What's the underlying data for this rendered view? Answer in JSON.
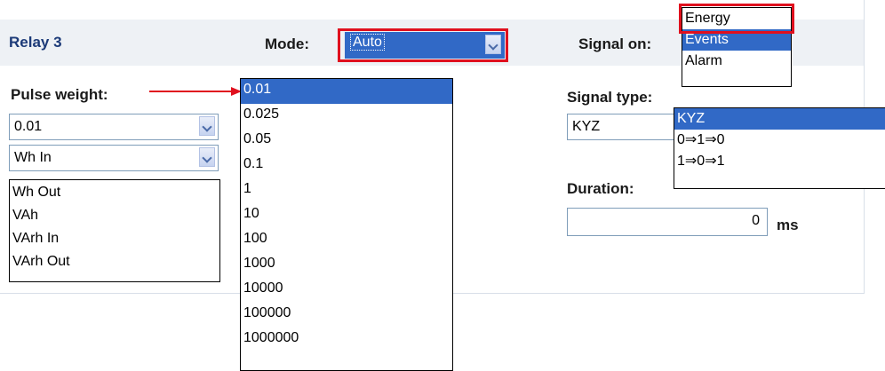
{
  "relay": {
    "title": "Relay 3",
    "mode_label": "Mode:",
    "mode_value": "Auto",
    "signal_on_label": "Signal on:",
    "signal_on_options": [
      "Energy",
      "Events",
      "Alarm"
    ],
    "pulse_weight_label": "Pulse weight:",
    "pulse_weight_value": "0.01",
    "pulse_weight_options": [
      "0.01",
      "0.025",
      "0.05",
      "0.1",
      "1",
      "10",
      "100",
      "1000",
      "10000",
      "100000",
      "1000000"
    ],
    "energy_unit_value": "Wh In",
    "energy_unit_options": [
      "Wh Out",
      "VAh",
      "VArh In",
      "VArh Out"
    ],
    "signal_type_label": "Signal type:",
    "signal_type_value": "KYZ",
    "signal_type_options": [
      "KYZ",
      "0⇒1⇒0",
      "1⇒0⇒1"
    ],
    "duration_label": "Duration:",
    "duration_value": "0",
    "duration_unit": "ms"
  },
  "colors": {
    "highlight": "#3169c6",
    "callout_red": "#e0101e",
    "title_blue": "#1c3a78"
  }
}
